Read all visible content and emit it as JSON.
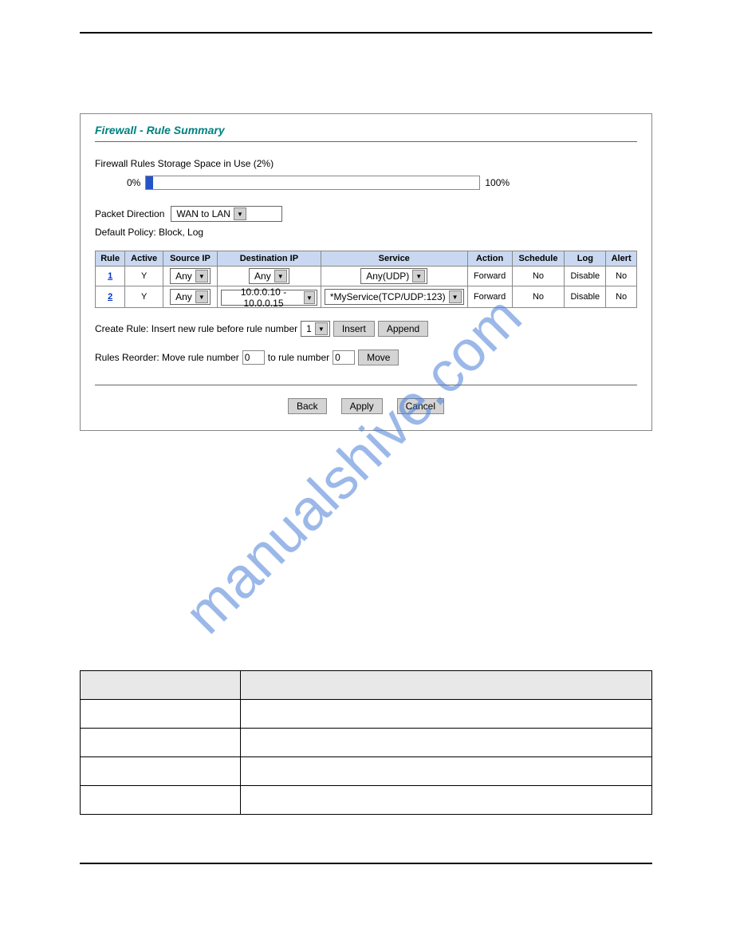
{
  "panel": {
    "title": "Firewall - Rule Summary",
    "storage_label": "Firewall Rules Storage Space in Use  (2%)",
    "progress": {
      "left": "0%",
      "right": "100%",
      "value_pct": 2
    },
    "packet_direction_label": "Packet Direction",
    "packet_direction_value": "WAN to LAN",
    "default_policy": "Default Policy: Block, Log"
  },
  "table": {
    "headers": [
      "Rule",
      "Active",
      "Source IP",
      "Destination IP",
      "Service",
      "Action",
      "Schedule",
      "Log",
      "Alert"
    ],
    "rows": [
      {
        "rule": "1",
        "active": "Y",
        "source_ip": "Any",
        "dest_ip": "Any",
        "service": "Any(UDP)",
        "action": "Forward",
        "schedule": "No",
        "log": "Disable",
        "alert": "No"
      },
      {
        "rule": "2",
        "active": "Y",
        "source_ip": "Any",
        "dest_ip": "10.0.0.10 - 10.0.0.15",
        "service": "*MyService(TCP/UDP:123)",
        "action": "Forward",
        "schedule": "No",
        "log": "Disable",
        "alert": "No"
      }
    ]
  },
  "create": {
    "label": "Create Rule: Insert new rule before rule number",
    "number_value": "1",
    "insert_btn": "Insert",
    "append_btn": "Append"
  },
  "reorder": {
    "label1": "Rules Reorder: Move rule number",
    "val1": "0",
    "label2": "to rule number",
    "val2": "0",
    "move_btn": "Move"
  },
  "bottom_buttons": {
    "back": "Back",
    "apply": "Apply",
    "cancel": "Cancel"
  },
  "watermark": "manualshive.com"
}
